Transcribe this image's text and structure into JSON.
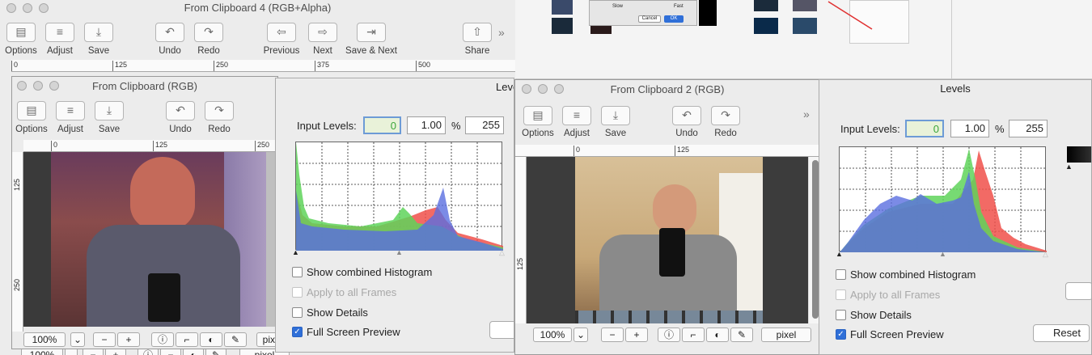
{
  "win4": {
    "title": "From Clipboard 4 (RGB+Alpha)",
    "toolbar": [
      "Options",
      "Adjust",
      "Save",
      "Undo",
      "Redo",
      "Previous",
      "Next",
      "Save & Next",
      "Share"
    ],
    "ruler": [
      "0",
      "125",
      "250",
      "375",
      "500"
    ]
  },
  "win1": {
    "title": "From Clipboard (RGB)",
    "toolbar": [
      "Options",
      "Adjust",
      "Save",
      "Undo",
      "Redo"
    ],
    "ruler": [
      "0",
      "125",
      "250"
    ],
    "vruler": [
      "125",
      "250"
    ],
    "zoom": "100%",
    "unit": "pixel"
  },
  "backbar": {
    "zoom": "100%",
    "unit": "pixel"
  },
  "levels1": {
    "title": "Levels",
    "input_label": "Input Levels:",
    "black": "0",
    "gamma": "1.00",
    "percent": "%",
    "white": "255",
    "options": [
      "Show combined Histogram",
      "Apply to all Frames",
      "Show Details",
      "Full Screen Preview"
    ]
  },
  "win2": {
    "title": "From Clipboard 2 (RGB)",
    "toolbar": [
      "Options",
      "Adjust",
      "Save",
      "Undo",
      "Redo"
    ],
    "ruler": [
      "0",
      "125"
    ],
    "vruler": [
      "125"
    ],
    "zoom": "100%",
    "unit": "pixel"
  },
  "levels2": {
    "title": "Levels",
    "input_label": "Input Levels:",
    "black": "0",
    "gamma": "1.00",
    "percent": "%",
    "white": "255",
    "options": [
      "Show combined Histogram",
      "Apply to all Frames",
      "Show Details",
      "Full Screen Preview"
    ],
    "reset": "Reset"
  },
  "bg_dialog": {
    "cancel": "Cancel",
    "ok": "OK",
    "slow": "Slow",
    "fast": "Fast"
  },
  "colors": {
    "accent": "#2f6fd8",
    "red": "#f0504a",
    "green": "#5fd35a",
    "blue": "#5a6ee0"
  }
}
